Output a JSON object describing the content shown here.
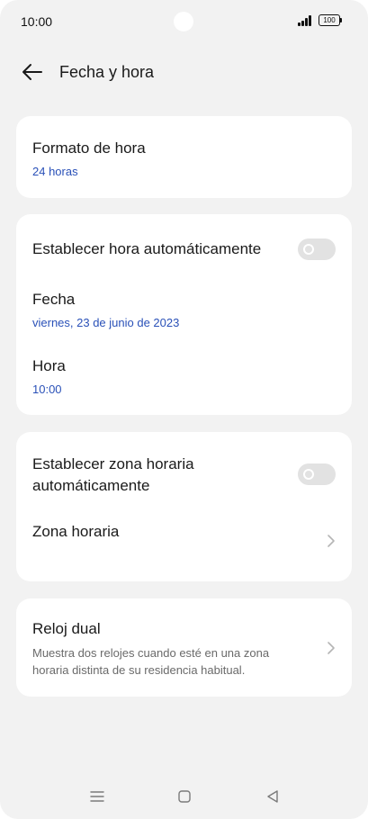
{
  "status_bar": {
    "time": "10:00",
    "battery": "100"
  },
  "header": {
    "title": "Fecha y hora"
  },
  "time_format": {
    "title": "Formato de hora",
    "value": "24 horas"
  },
  "datetime": {
    "auto_time_label": "Establecer hora automáticamente",
    "auto_time_enabled": false,
    "date_label": "Fecha",
    "date_value": "viernes, 23 de junio de 2023",
    "time_label": "Hora",
    "time_value": "10:00"
  },
  "timezone": {
    "auto_timezone_label_line1": "Establecer zona horaria",
    "auto_timezone_label_line2": "automáticamente",
    "auto_timezone_enabled": false,
    "zone_label": "Zona horaria"
  },
  "dual_clock": {
    "title": "Reloj dual",
    "description_line1": "Muestra dos relojes cuando esté en una zona",
    "description_line2": "horaria distinta de su residencia habitual."
  },
  "colors": {
    "background": "#f2f2f2",
    "card": "#ffffff",
    "accent_blue": "#2a51b8",
    "toggle_off": "#e2e2e2"
  },
  "icons": {
    "back": "arrow-left-icon",
    "chevron": "chevron-right-icon",
    "nav_menu": "menu-icon",
    "nav_home": "home-square-icon",
    "nav_back": "back-triangle-icon"
  }
}
